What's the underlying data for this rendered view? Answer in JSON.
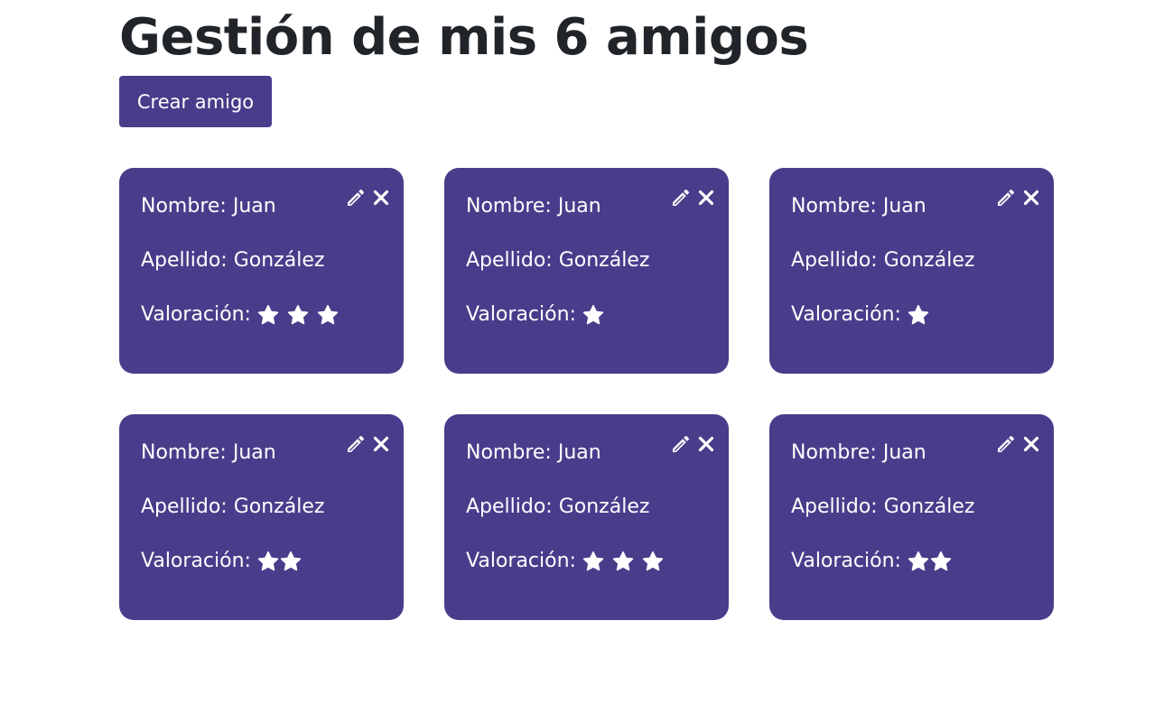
{
  "page": {
    "title": "Gestión de mis 6 amigos",
    "create_button_label": "Crear amigo"
  },
  "colors": {
    "accent": "#483d8b",
    "text_dark": "#212529",
    "card_text": "#ffffff"
  },
  "labels": {
    "nombre": "Nombre:",
    "apellido": "Apellido:",
    "valoracion": "Valoración:"
  },
  "icons": {
    "edit": "pencil-icon",
    "delete": "close-icon",
    "rating": "star-icon"
  },
  "friends": [
    {
      "nombre": "Juan",
      "apellido": "González",
      "valoracion": 3
    },
    {
      "nombre": "Juan",
      "apellido": "González",
      "valoracion": 1
    },
    {
      "nombre": "Juan",
      "apellido": "González",
      "valoracion": 1
    },
    {
      "nombre": "Juan",
      "apellido": "González",
      "valoracion": 2
    },
    {
      "nombre": "Juan",
      "apellido": "González",
      "valoracion": 3
    },
    {
      "nombre": "Juan",
      "apellido": "González",
      "valoracion": 2
    }
  ]
}
